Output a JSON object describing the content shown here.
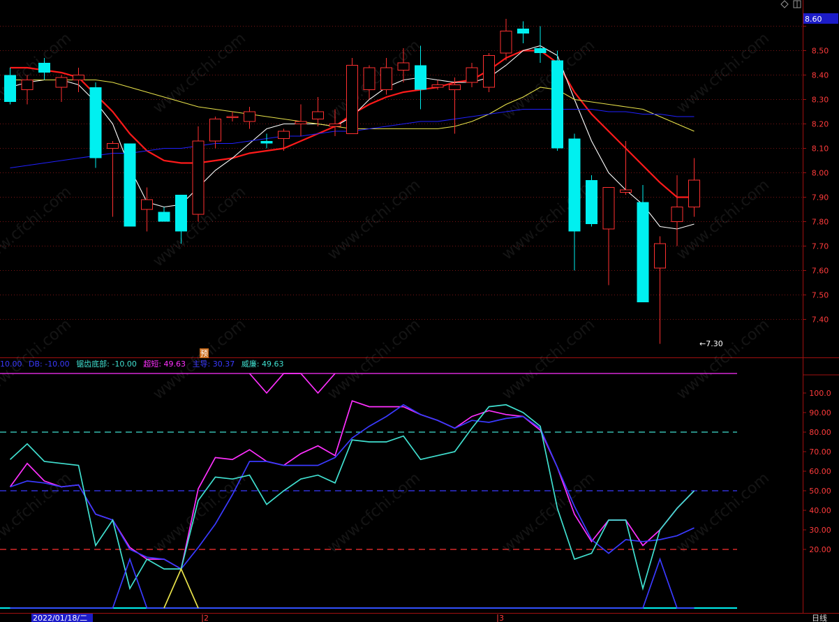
{
  "toolbar": {
    "diamond_icon": "diamond-icon",
    "window_icon": "window-icon"
  },
  "price_badge": "8.60",
  "yu_badge": "预",
  "min_marker": "←7.30",
  "watermark": "www.cfchi.com",
  "indicator_header": {
    "items": [
      {
        "text": "10.00",
        "color": "#3a3aff"
      },
      {
        "text": "DB: -10.00",
        "color": "#3a3aff"
      },
      {
        "text": "锯齿底部: -10.00",
        "color": "#40e0d0"
      },
      {
        "text": "超短: 49.63",
        "color": "#ff30ff"
      },
      {
        "text": "主导: 30.37",
        "color": "#3a3aff"
      },
      {
        "text": "威廉: 49.63",
        "color": "#40e0d0"
      }
    ]
  },
  "bottom_bar": {
    "date_label": "2022/01/18/二",
    "tick_2": "2",
    "tick_3": "3",
    "period_label": "日线"
  },
  "colors": {
    "up": "#ff3030",
    "down": "#00f0f0",
    "axis": "#ff3b3b",
    "ma_red": "#ff1a1a",
    "ma_white": "#ffffff",
    "ma_yellow": "#e8e24a",
    "ma_blue": "#2020ff"
  },
  "chart_data": [
    {
      "type": "candlestick",
      "title": "",
      "yaxis_ticks": [
        "8.60",
        "8.50",
        "8.40",
        "8.30",
        "8.20",
        "8.10",
        "8.00",
        "7.90",
        "7.80",
        "7.70",
        "7.60",
        "7.50",
        "7.40"
      ],
      "ylim": [
        7.3,
        8.63
      ],
      "grid": true,
      "candles": [
        {
          "o": 8.4,
          "h": 8.43,
          "l": 8.28,
          "c": 8.29
        },
        {
          "o": 8.34,
          "h": 8.4,
          "l": 8.28,
          "c": 8.38
        },
        {
          "o": 8.45,
          "h": 8.47,
          "l": 8.38,
          "c": 8.41
        },
        {
          "o": 8.35,
          "h": 8.4,
          "l": 8.29,
          "c": 8.39
        },
        {
          "o": 8.38,
          "h": 8.43,
          "l": 8.33,
          "c": 8.4
        },
        {
          "o": 8.35,
          "h": 8.37,
          "l": 8.02,
          "c": 8.06
        },
        {
          "o": 8.1,
          "h": 8.13,
          "l": 7.82,
          "c": 8.12
        },
        {
          "o": 8.12,
          "h": 8.12,
          "l": 7.78,
          "c": 7.78
        },
        {
          "o": 7.85,
          "h": 7.94,
          "l": 7.76,
          "c": 7.89
        },
        {
          "o": 7.84,
          "h": 7.86,
          "l": 7.8,
          "c": 7.8
        },
        {
          "o": 7.91,
          "h": 7.91,
          "l": 7.71,
          "c": 7.76
        },
        {
          "o": 7.83,
          "h": 8.19,
          "l": 7.8,
          "c": 8.13
        },
        {
          "o": 8.13,
          "h": 8.23,
          "l": 8.1,
          "c": 8.22
        },
        {
          "o": 8.23,
          "h": 8.25,
          "l": 8.21,
          "c": 8.23
        },
        {
          "o": 8.21,
          "h": 8.27,
          "l": 8.18,
          "c": 8.25
        },
        {
          "o": 8.13,
          "h": 8.16,
          "l": 8.1,
          "c": 8.12
        },
        {
          "o": 8.14,
          "h": 8.18,
          "l": 8.09,
          "c": 8.17
        },
        {
          "o": 8.2,
          "h": 8.28,
          "l": 8.15,
          "c": 8.21
        },
        {
          "o": 8.22,
          "h": 8.31,
          "l": 8.19,
          "c": 8.25
        },
        {
          "o": 8.19,
          "h": 8.26,
          "l": 8.15,
          "c": 8.2
        },
        {
          "o": 8.16,
          "h": 8.47,
          "l": 8.16,
          "c": 8.44
        },
        {
          "o": 8.34,
          "h": 8.44,
          "l": 8.3,
          "c": 8.43
        },
        {
          "o": 8.34,
          "h": 8.47,
          "l": 8.32,
          "c": 8.43
        },
        {
          "o": 8.42,
          "h": 8.51,
          "l": 8.37,
          "c": 8.45
        },
        {
          "o": 8.44,
          "h": 8.52,
          "l": 8.26,
          "c": 8.34
        },
        {
          "o": 8.35,
          "h": 8.38,
          "l": 8.34,
          "c": 8.36
        },
        {
          "o": 8.34,
          "h": 8.39,
          "l": 8.16,
          "c": 8.36
        },
        {
          "o": 8.37,
          "h": 8.45,
          "l": 8.35,
          "c": 8.43
        },
        {
          "o": 8.35,
          "h": 8.49,
          "l": 8.33,
          "c": 8.48
        },
        {
          "o": 8.49,
          "h": 8.63,
          "l": 8.46,
          "c": 8.58
        },
        {
          "o": 8.59,
          "h": 8.62,
          "l": 8.53,
          "c": 8.57
        },
        {
          "o": 8.51,
          "h": 8.6,
          "l": 8.45,
          "c": 8.49
        },
        {
          "o": 8.46,
          "h": 8.5,
          "l": 8.09,
          "c": 8.1
        },
        {
          "o": 8.14,
          "h": 8.16,
          "l": 7.6,
          "c": 7.76
        },
        {
          "o": 7.97,
          "h": 7.99,
          "l": 7.78,
          "c": 7.79
        },
        {
          "o": 7.77,
          "h": 7.94,
          "l": 7.54,
          "c": 7.94
        },
        {
          "o": 7.92,
          "h": 8.13,
          "l": 7.91,
          "c": 7.93
        },
        {
          "o": 7.88,
          "h": 7.95,
          "l": 7.47,
          "c": 7.47
        },
        {
          "o": 7.61,
          "h": 7.74,
          "l": 7.3,
          "c": 7.71
        },
        {
          "o": 7.8,
          "h": 7.99,
          "l": 7.7,
          "c": 7.86
        },
        {
          "o": 7.86,
          "h": 8.06,
          "l": 7.82,
          "c": 7.97
        }
      ],
      "series": [
        {
          "color": "#ff1a1a",
          "values": [
            8.43,
            8.43,
            8.42,
            8.41,
            8.39,
            8.32,
            8.25,
            8.16,
            8.09,
            8.05,
            8.04,
            8.04,
            8.05,
            8.06,
            8.08,
            8.09,
            8.1,
            8.13,
            8.16,
            8.19,
            8.24,
            8.28,
            8.31,
            8.33,
            8.34,
            8.35,
            8.37,
            8.38,
            8.42,
            8.47,
            8.5,
            8.5,
            8.45,
            8.33,
            8.24,
            8.17,
            8.1,
            8.03,
            7.96,
            7.9,
            7.9
          ]
        },
        {
          "color": "#ffffff",
          "values": [
            8.35,
            8.37,
            8.38,
            8.38,
            8.36,
            8.29,
            8.2,
            8.02,
            7.88,
            7.86,
            7.87,
            7.94,
            8.01,
            8.06,
            8.12,
            8.18,
            8.2,
            8.2,
            8.2,
            8.19,
            8.23,
            8.3,
            8.35,
            8.38,
            8.39,
            8.38,
            8.37,
            8.37,
            8.39,
            8.44,
            8.5,
            8.52,
            8.48,
            8.3,
            8.13,
            8.0,
            7.93,
            7.87,
            7.78,
            7.77,
            7.79
          ]
        },
        {
          "color": "#e8e24a",
          "values": [
            8.38,
            8.38,
            8.38,
            8.38,
            8.38,
            8.38,
            8.37,
            8.35,
            8.33,
            8.31,
            8.29,
            8.27,
            8.26,
            8.25,
            8.24,
            8.23,
            8.22,
            8.21,
            8.2,
            8.19,
            8.18,
            8.18,
            8.18,
            8.18,
            8.18,
            8.18,
            8.19,
            8.21,
            8.24,
            8.28,
            8.31,
            8.35,
            8.34,
            8.3,
            8.29,
            8.28,
            8.27,
            8.26,
            8.23,
            8.2,
            8.17
          ]
        },
        {
          "color": "#2020ff",
          "values": [
            8.02,
            8.03,
            8.04,
            8.05,
            8.06,
            8.07,
            8.08,
            8.08,
            8.09,
            8.1,
            8.1,
            8.11,
            8.12,
            8.12,
            8.13,
            8.14,
            8.15,
            8.15,
            8.16,
            8.17,
            8.17,
            8.18,
            8.19,
            8.2,
            8.21,
            8.21,
            8.22,
            8.23,
            8.24,
            8.25,
            8.26,
            8.26,
            8.26,
            8.26,
            8.26,
            8.25,
            8.25,
            8.24,
            8.24,
            8.23,
            8.23
          ]
        }
      ]
    },
    {
      "type": "line",
      "title": "",
      "yaxis_ticks": [
        "100.0",
        "90.00",
        "80.00",
        "70.00",
        "60.00",
        "50.00",
        "40.00",
        "30.00",
        "20.00"
      ],
      "ylim": [
        -10,
        115
      ],
      "grid": false,
      "reference_lines": [
        {
          "y": 110,
          "color": "#ff30ff",
          "dash": false
        },
        {
          "y": 80,
          "color": "#40e0d0",
          "dash": true
        },
        {
          "y": 50,
          "color": "#3a3aff",
          "dash": true
        },
        {
          "y": 20,
          "color": "#ff3030",
          "dash": true
        },
        {
          "y": -10,
          "color": "#00f0f0",
          "dash": false
        }
      ],
      "series": [
        {
          "name": "超短",
          "color": "#ff30ff",
          "values": [
            52,
            64,
            55,
            52,
            53,
            38,
            35,
            21,
            15,
            15,
            10,
            51,
            67,
            66,
            71,
            65,
            63,
            69,
            73,
            68,
            96,
            93,
            93,
            93,
            89,
            86,
            82,
            88,
            91,
            89,
            88,
            81,
            62,
            38,
            24,
            35,
            35,
            22,
            30,
            41,
            50
          ]
        },
        {
          "name": "主导",
          "color": "#3a3aff",
          "values": [
            52,
            55,
            54,
            52,
            53,
            38,
            35,
            20,
            16,
            15,
            10,
            21,
            33,
            48,
            65,
            65,
            63,
            63,
            63,
            67,
            77,
            83,
            88,
            94,
            89,
            86,
            82,
            86,
            85,
            87,
            88,
            82,
            62,
            42,
            25,
            18,
            25,
            24,
            25,
            27,
            31
          ]
        },
        {
          "name": "威廉",
          "color": "#40e0d0",
          "values": [
            66,
            74,
            65,
            64,
            63,
            22,
            35,
            0,
            15,
            10,
            10,
            45,
            57,
            56,
            58,
            43,
            50,
            56,
            58,
            54,
            76,
            75,
            75,
            78,
            66,
            68,
            70,
            82,
            93,
            94,
            90,
            83,
            41,
            15,
            18,
            35,
            35,
            0,
            30,
            41,
            50
          ]
        },
        {
          "name": "锯齿底部",
          "color": "#3a3aff",
          "values": [
            -10,
            -10,
            -10,
            -10,
            -10,
            -10,
            -10,
            15,
            -10,
            -10,
            -10,
            -10,
            -10,
            -10,
            -10,
            -10,
            -10,
            -10,
            -10,
            -10,
            -10,
            -10,
            -10,
            -10,
            -10,
            -10,
            -10,
            -10,
            -10,
            -10,
            -10,
            -10,
            -10,
            -10,
            -10,
            -10,
            -10,
            -10,
            15,
            -10,
            -10
          ]
        },
        {
          "name": "DB",
          "color": "#e8e24a",
          "values": [
            null,
            null,
            null,
            null,
            null,
            null,
            null,
            null,
            null,
            -10,
            10,
            -10,
            null,
            null,
            null,
            null,
            null,
            null,
            null,
            null,
            null,
            null,
            null,
            null,
            null,
            null,
            null,
            null,
            null,
            null,
            null,
            null,
            null,
            null,
            null,
            null,
            null,
            null,
            null,
            null,
            null
          ]
        },
        {
          "name": "pink_top",
          "color": "#ff30ff",
          "values": [
            null,
            null,
            null,
            null,
            null,
            null,
            null,
            null,
            null,
            null,
            null,
            null,
            null,
            null,
            110,
            100,
            110,
            110,
            100,
            110,
            null,
            null,
            null,
            null,
            null,
            null,
            null,
            null,
            null,
            null,
            null,
            null,
            null,
            null,
            null,
            null,
            null,
            null,
            null,
            null,
            null
          ]
        }
      ]
    }
  ]
}
